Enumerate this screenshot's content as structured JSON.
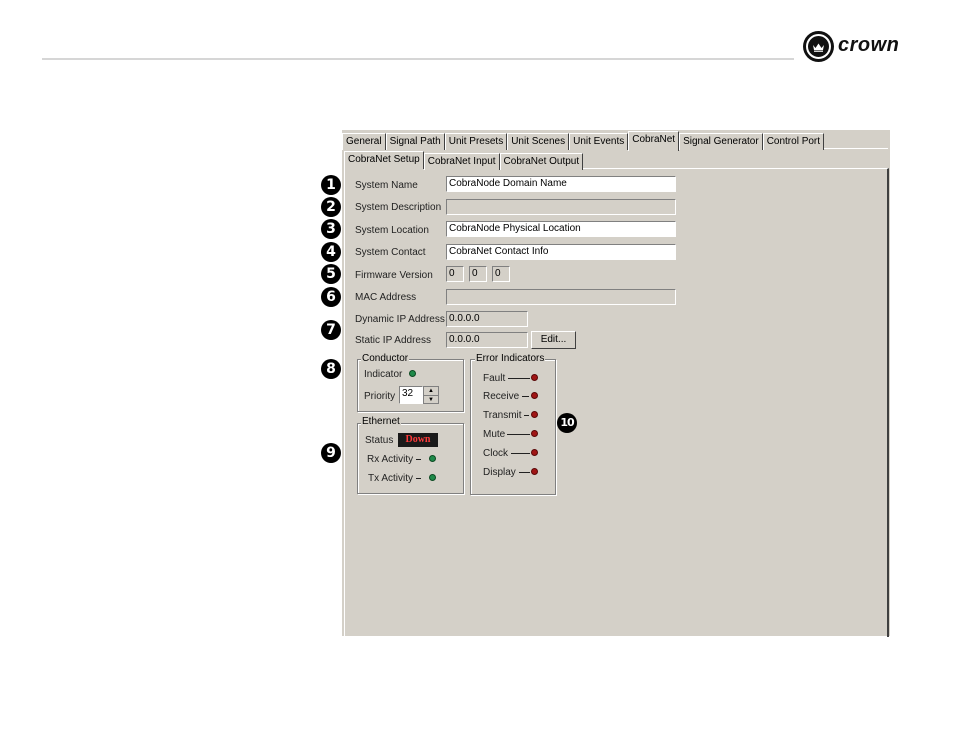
{
  "brand": {
    "logo_text": "crown"
  },
  "tabs": [
    "General",
    "Signal Path",
    "Unit Presets",
    "Unit Scenes",
    "Unit Events",
    "CobraNet",
    "Signal Generator",
    "Control Port"
  ],
  "active_tab": "CobraNet",
  "subtabs": [
    "CobraNet Setup",
    "CobraNet Input",
    "CobraNet Output"
  ],
  "active_subtab": "CobraNet Setup",
  "fields": {
    "system_name": {
      "label": "System Name",
      "value": "CobraNode Domain Name"
    },
    "system_description": {
      "label": "System Description",
      "value": ""
    },
    "system_location": {
      "label": "System Location",
      "value": "CobraNode Physical Location"
    },
    "system_contact": {
      "label": "System Contact",
      "value": "CobraNet Contact Info"
    },
    "firmware_version": {
      "label": "Firmware Version",
      "values": [
        "0",
        "0",
        "0"
      ]
    },
    "mac_address": {
      "label": "MAC Address",
      "value": ""
    },
    "dynamic_ip": {
      "label": "Dynamic IP Address",
      "value": "0.0.0.0"
    },
    "static_ip": {
      "label": "Static IP Address",
      "value": "0.0.0.0",
      "button": "Edit..."
    }
  },
  "conductor": {
    "title": "Conductor",
    "indicator_label": "Indicator",
    "priority_label": "Priority",
    "priority_value": "32"
  },
  "ethernet": {
    "title": "Ethernet",
    "status_label": "Status",
    "status_value": "Down",
    "rx_label": "Rx Activity",
    "tx_label": "Tx Activity"
  },
  "error_indicators": {
    "title": "Error Indicators",
    "items": [
      "Fault",
      "Receive",
      "Transmit",
      "Mute",
      "Clock",
      "Display"
    ]
  },
  "markers": [
    "1",
    "2",
    "3",
    "4",
    "5",
    "6",
    "7",
    "8",
    "9",
    "10"
  ],
  "colors": {
    "led_green": "#1f8a4a",
    "led_red": "#a01515",
    "status_badge": "#1a1a1a",
    "status_text": "#ff3b3b",
    "panel": "#d4d0c8"
  }
}
